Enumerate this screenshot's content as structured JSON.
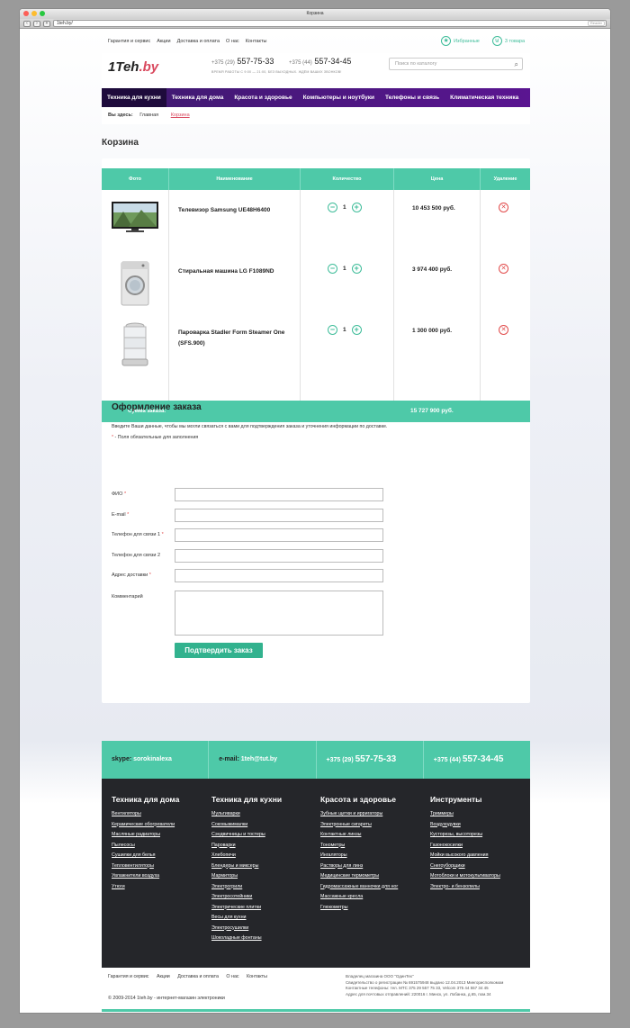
{
  "browser": {
    "title": "Корзина",
    "url": "1teh.by/",
    "reader": "Reader"
  },
  "topnav": {
    "links": [
      "Гарантия и сервис",
      "Акции",
      "Доставка и оплата",
      "О нас",
      "Контакты"
    ],
    "favorites": "Избранные",
    "cart_count": "3 товара"
  },
  "header": {
    "logo_main": "1Teh",
    "logo_suffix": ".by",
    "phone1_code": "+375 (29)",
    "phone1": "557-75-33",
    "phone2_code": "+375 (44)",
    "phone2": "557-34-45",
    "hours": "ВРЕМЯ РАБОТЫ С 9:00 — 21:00, БЕЗ ВЫХОДНЫХ. ЖДЁМ ВАШИХ ЗВОНКОВ!",
    "search_placeholder": "Поиск по каталогу"
  },
  "mainnav": [
    "Техника для кухни",
    "Техника для дома",
    "Красота и здоровье",
    "Компьютеры и ноутбуки",
    "Телефоны и связь",
    "Климатическая техника"
  ],
  "breadcrumb": {
    "label": "Вы здесь:",
    "home": "Главная",
    "current": "Корзина"
  },
  "page_title": "Корзина",
  "cart": {
    "headers": {
      "photo": "Фото",
      "name": "Наименование",
      "qty": "Количество",
      "price": "Цена",
      "delete": "Удаление"
    },
    "items": [
      {
        "name": "Телевизор Samsung UE48H6400",
        "qty": "1",
        "price": "10 453 500 руб."
      },
      {
        "name": "Стиральная машина LG F1089ND",
        "qty": "1",
        "price": "3 974 400 руб."
      },
      {
        "name": "Пароварка Stadler Form Steamer One (SFS.900)",
        "qty": "1",
        "price": "1 300 000 руб."
      }
    ],
    "total_label": "Сумма заказа:",
    "total_value": "15 727 900 руб."
  },
  "checkout": {
    "title": "Оформление заказа",
    "intro": "Введите Ваши данные, чтобы мы могли связаться с вами для подтверждения заказа и уточнения информации по доставке.",
    "required_note": "- Поля обязательные для заполнения",
    "fields": [
      "ФИО",
      "E-mail",
      "Телефон для связи 1",
      "Телефон для связи 2",
      "Адрес доставки",
      "Комментарий"
    ],
    "submit": "Подтвердить заказ"
  },
  "contacts": {
    "skype_label": "skype:",
    "skype": "sorokinalexa",
    "email_label": "e-mail:",
    "email": "1teh@tut.by",
    "phone1_code": "+375 (29)",
    "phone1": "557-75-33",
    "phone2_code": "+375 (44)",
    "phone2": "557-34-45"
  },
  "footer": {
    "columns": [
      {
        "title": "Техника для дома",
        "links": [
          "Вентиляторы",
          "Керамические обогреватели",
          "Масляные радиаторы",
          "Пылесосы",
          "Сушилки для белья",
          "Тепловентиляторы",
          "Увлажнители воздуха",
          "Утюги"
        ]
      },
      {
        "title": "Техника для кухни",
        "links": [
          "Мультиварки",
          "Соковыжималки",
          "Сэндвичницы и тостеры",
          "Пароварки",
          "Хлебопечи",
          "Блендеры и миксеры",
          "Мармиторы",
          "Электрогрили",
          "Электросотейники",
          "Электрические плитки",
          "Весы для кухни",
          "Электросушилки",
          "Шоколадные фонтаны"
        ]
      },
      {
        "title": "Красота и здоровье",
        "links": [
          "Зубные щетки и ирригаторы",
          "Электронные сигареты",
          "Контактные линзы",
          "Тонометры",
          "Ингаляторы",
          "Растворы для линз",
          "Медицинские термометры",
          "Гидромассажные ванночки для ног",
          "Массажные кресла",
          "Глюкометры"
        ]
      },
      {
        "title": "Инструменты",
        "links": [
          "Триммеры",
          "Воздуходувки",
          "Кусторезы, высоторезы",
          "Газонокосилки",
          "Мойки высокого давления",
          "Снегоуборщики",
          "Мотоблоки и мотокультиваторы",
          "Электро- и бензопилы"
        ]
      }
    ]
  },
  "bottom": {
    "links": [
      "Гарантия и сервис",
      "Акции",
      "Доставка и оплата",
      "О нас",
      "Контакты"
    ],
    "copyright": "© 2009-2014 1teh.by - интернет-магазин электроники",
    "legal": [
      "Владелец магазина ООО \"ОдинТех\"",
      "Свидетельство о регистрации № 691575948 выдано 12.04.2013 Мингорисполкомом",
      "Контактные телефоны: тел. МТС 375 29 557 75 33, Velcom 375 44 557 34 45",
      "Адрес для почтовых отправлений: 220016 г. Минск, ул. Лобанка, д.65, пом.34"
    ]
  }
}
